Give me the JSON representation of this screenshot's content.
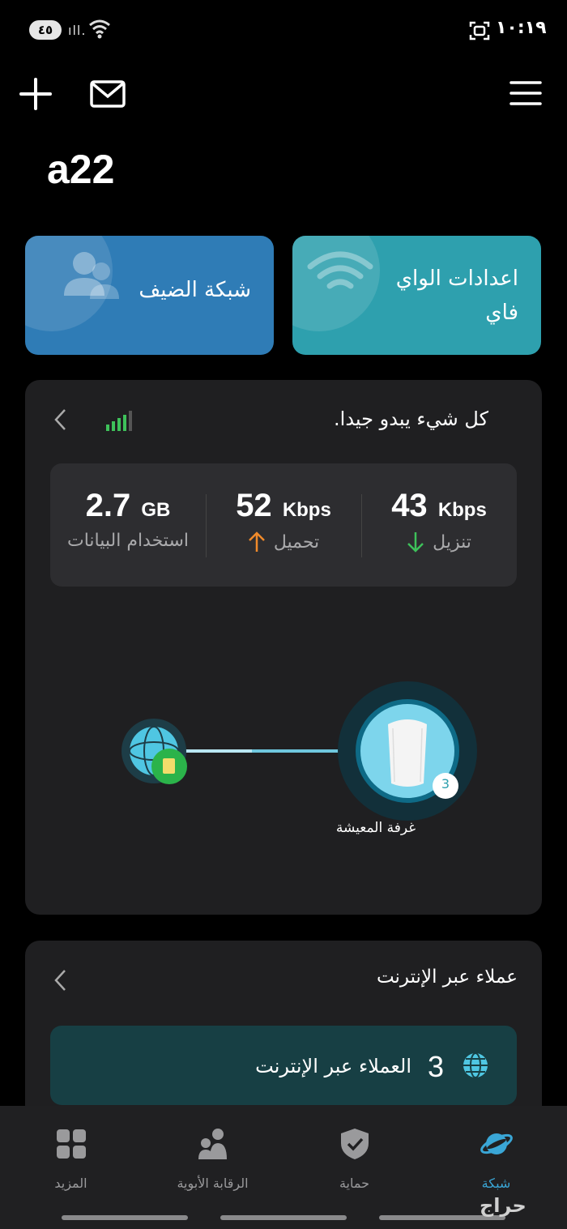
{
  "status_bar": {
    "battery": "٤٥",
    "signal": "ıll.",
    "time": "١٠:١٩"
  },
  "header": {
    "network_name": "a22"
  },
  "quick_actions": {
    "guest_network": "شبكة الضيف",
    "wifi_settings": "اعدادات الواي فاي"
  },
  "status": {
    "message": "كل شيء يبدو جيدا.",
    "stats": {
      "download": {
        "value": "43",
        "unit": "Kbps",
        "label": "تنزيل",
        "color": "#3ec15a"
      },
      "upload": {
        "value": "52",
        "unit": "Kbps",
        "label": "تحميل",
        "color": "#f08a2a"
      },
      "data_usage": {
        "value": "2.7",
        "unit": "GB",
        "label": "استخدام البيانات"
      }
    },
    "topology": {
      "node_name": "غرفة المعيشة",
      "node_clients": "3"
    }
  },
  "clients": {
    "title": "عملاء عبر الإنترنت",
    "count": "3",
    "label": "العملاء عبر الإنترنت"
  },
  "bottom_nav": {
    "items": [
      {
        "label": "المزيد",
        "icon": "grid-icon"
      },
      {
        "label": "الرقابة الأبوية",
        "icon": "family-icon"
      },
      {
        "label": "حماية",
        "icon": "shield-icon"
      },
      {
        "label": "شبكة",
        "icon": "planet-icon",
        "active": true
      }
    ]
  },
  "colors": {
    "accent": "#3aa6d6",
    "guest_card": "#2f7cb6",
    "wifi_card": "#2ea0ae"
  },
  "watermark": "حراج"
}
